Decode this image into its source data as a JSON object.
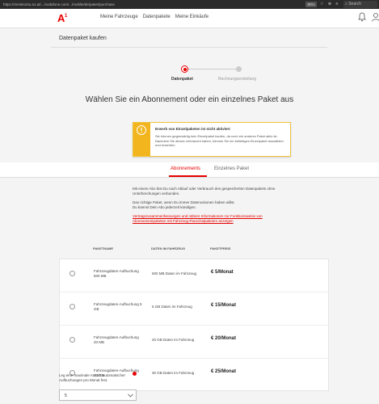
{
  "browser": {
    "url": "https://meinkonto.a1.at/.../vodafone.com/.../mobile/de/paket/purchase",
    "zoom": "90%",
    "search": "Search"
  },
  "header": {
    "logo_text": "A1",
    "nav": [
      "Meine Fahrzeuge",
      "Datenpakete",
      "Meine Einkäufe"
    ]
  },
  "page": {
    "title": "Datenpaket kaufen",
    "heading": "Wählen Sie ein Abonnement oder ein einzelnes Paket aus"
  },
  "steps": [
    {
      "label": "Datenpaket"
    },
    {
      "label": "Rechnungserstellung"
    }
  ],
  "warning": {
    "title": "Erwerb von Einzelpaketen ist nicht aktiviert",
    "text": "Sie können gegenwärtig kein Einzelpaket kaufen, da noch ein anderes Paket aktiv ist. Nachdem Sie dieses verbraucht haben, können Sie ein beliebiges Einzelpaket auswählen und erwerben."
  },
  "tabs": [
    {
      "label": "Abonnements",
      "active": true
    },
    {
      "label": "Einzelnes Paket",
      "active": false
    }
  ],
  "info": {
    "p1": "Mit einem Abo bist Du nach Ablauf oder Verbrauch des gespeicherten Datenpakets ohne Unterbrechungen verbunden.",
    "p2": "Das richtige Paket, wenn Du immer Datenvolumen haben willst.",
    "p3": "Du kannst Dein Abo jederzeit kündigen.",
    "link": "Vertragszusammenfassungen und nähere Informationen zur Funktionsweise von Abonnementpaketen mit Fahrzeug-Pauschalpaketen anzeigen"
  },
  "table": {
    "headers": [
      "PAKETNAME",
      "DATEN IM FAHRZEUG",
      "PAKETPREIS"
    ],
    "rows": [
      {
        "name": "Fahrzeugdaten-Aufbuchung 500 MB",
        "data": "500 MB Daten im Fahrzeug",
        "price": "€ 5/Monat"
      },
      {
        "name": "Fahrzeugdaten-Aufbuchung 5 GB",
        "data": "5 GB Daten im Fahrzeug",
        "price": "€ 15/Monat"
      },
      {
        "name": "Fahrzeugdaten-Aufbuchung 20 MB",
        "data": "20 GB Daten im Fahrzeug",
        "price": "€ 20/Monat"
      },
      {
        "name": "Fahrzeugdaten-Aufbuchung 30 GB",
        "data": "30 GB Daten im Fahrzeug",
        "price": "€ 25/Monat"
      }
    ]
  },
  "footer": {
    "label": "Leg eine maximale Anzahl automatischer Aufbuchungen pro Monat fest.",
    "select_value": "5"
  },
  "colors": {
    "accent": "#e60000",
    "warning": "#f2b51d"
  }
}
